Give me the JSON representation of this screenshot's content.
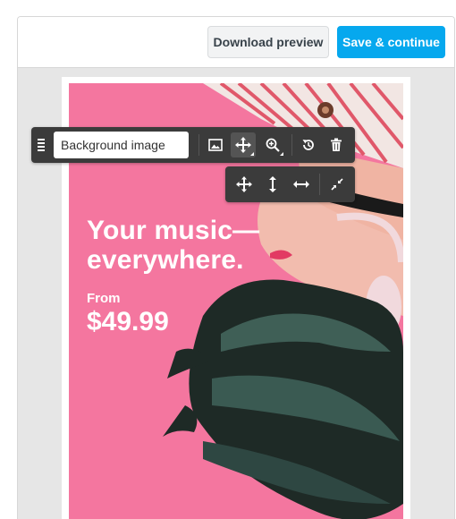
{
  "header": {
    "download_label": "Download preview",
    "save_label": "Save & continue"
  },
  "ad": {
    "headline_line1": "Your music—",
    "headline_line2": "everywhere.",
    "from_label": "From",
    "price": "$49.99"
  },
  "toolbar": {
    "layer_name": "Background image",
    "icons": [
      "drag-handle-icon",
      "image-icon",
      "move-icon",
      "zoom-icon",
      "reset-icon",
      "trash-icon"
    ]
  },
  "subtoolbar": {
    "icons": [
      "move-both-icon",
      "move-vertical-icon",
      "move-horizontal-icon",
      "shrink-icon"
    ]
  },
  "colors": {
    "primary": "#06a8ee",
    "ad_background": "#f4769f",
    "toolbar": "#3b3b3b"
  }
}
